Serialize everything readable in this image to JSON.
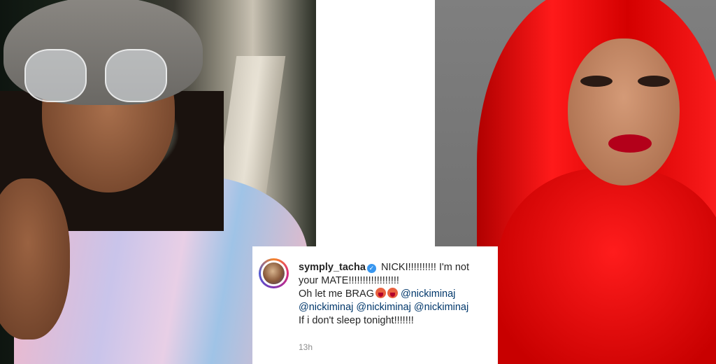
{
  "comment": {
    "username": "symply_tacha",
    "line1": "NICKI!!!!!!!!!! I'm not",
    "line2": "your MATE!!!!!!!!!!!!!!!!!!",
    "line3_text": "Oh let me BRAG",
    "mention": "@nickiminaj",
    "line5": "If i don't sleep tonight!!!!!!!",
    "timestamp": "13h"
  },
  "icons": {
    "verified": "verified-badge-icon",
    "emoji": "tongue-emoji-icon"
  },
  "colors": {
    "verified_blue": "#3897f0",
    "mention_blue": "#00376b",
    "text": "#262626",
    "timestamp": "#8e8e8e"
  }
}
